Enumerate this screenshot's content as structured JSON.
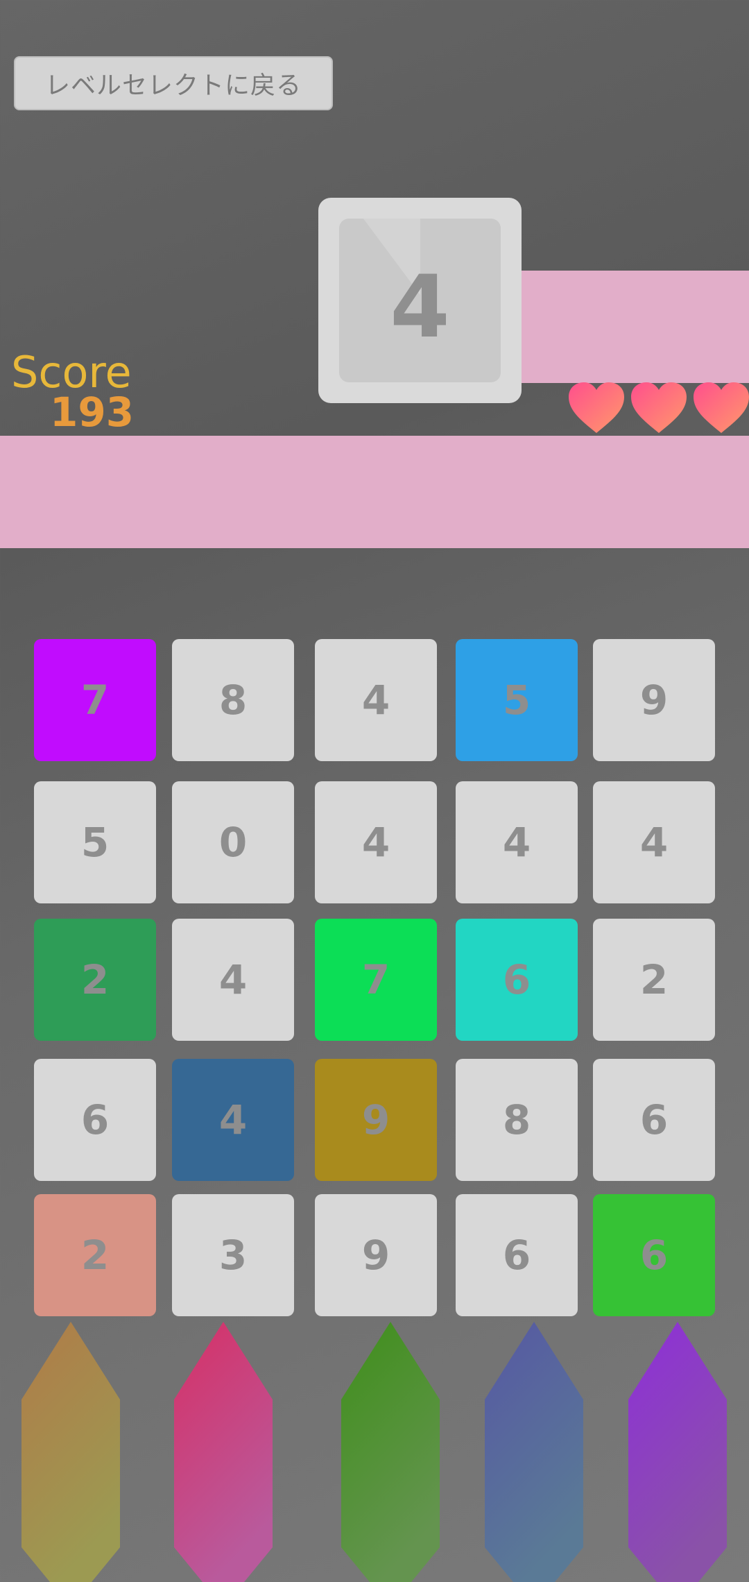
{
  "header": {
    "back_button_label": "レベルセレクトに戻る"
  },
  "next_tile": {
    "value": "4"
  },
  "score": {
    "label": "Score",
    "value": "193"
  },
  "lives": {
    "count": 3,
    "icon": "heart-icon",
    "color": "#ff5f96"
  },
  "grid": {
    "rows": [
      [
        {
          "v": "7",
          "c": "#c10cfe"
        },
        {
          "v": "8",
          "c": "#d8d8d8"
        },
        {
          "v": "4",
          "c": "#d8d8d8"
        },
        {
          "v": "5",
          "c": "#2ea0e6"
        },
        {
          "v": "9",
          "c": "#d8d8d8"
        }
      ],
      [
        {
          "v": "5",
          "c": "#d8d8d8"
        },
        {
          "v": "0",
          "c": "#d8d8d8"
        },
        {
          "v": "4",
          "c": "#d8d8d8"
        },
        {
          "v": "4",
          "c": "#d8d8d8"
        },
        {
          "v": "4",
          "c": "#d8d8d8"
        }
      ],
      [
        {
          "v": "2",
          "c": "#2e9d57"
        },
        {
          "v": "4",
          "c": "#d8d8d8"
        },
        {
          "v": "7",
          "c": "#0cde56"
        },
        {
          "v": "6",
          "c": "#22d6c3"
        },
        {
          "v": "2",
          "c": "#d8d8d8"
        }
      ],
      [
        {
          "v": "6",
          "c": "#d8d8d8"
        },
        {
          "v": "4",
          "c": "#366894"
        },
        {
          "v": "9",
          "c": "#a98b1d"
        },
        {
          "v": "8",
          "c": "#d8d8d8"
        },
        {
          "v": "6",
          "c": "#d8d8d8"
        }
      ],
      [
        {
          "v": "2",
          "c": "#d89385"
        },
        {
          "v": "3",
          "c": "#d8d8d8"
        },
        {
          "v": "9",
          "c": "#d8d8d8"
        },
        {
          "v": "6",
          "c": "#d8d8d8"
        },
        {
          "v": "6",
          "c": "#36c235"
        }
      ]
    ]
  },
  "pencils": [
    {
      "name": "orange-pencil",
      "top": "#b07b48",
      "bottom": "#9c9a52"
    },
    {
      "name": "pink-pencil",
      "top": "#d63066",
      "bottom": "#b95a9c"
    },
    {
      "name": "green-pencil",
      "top": "#3f8f1b",
      "bottom": "#64944f"
    },
    {
      "name": "blue-pencil",
      "top": "#5658a3",
      "bottom": "#5a7a96"
    },
    {
      "name": "purple-pencil",
      "top": "#8e2fd8",
      "bottom": "#8a52a8"
    }
  ]
}
